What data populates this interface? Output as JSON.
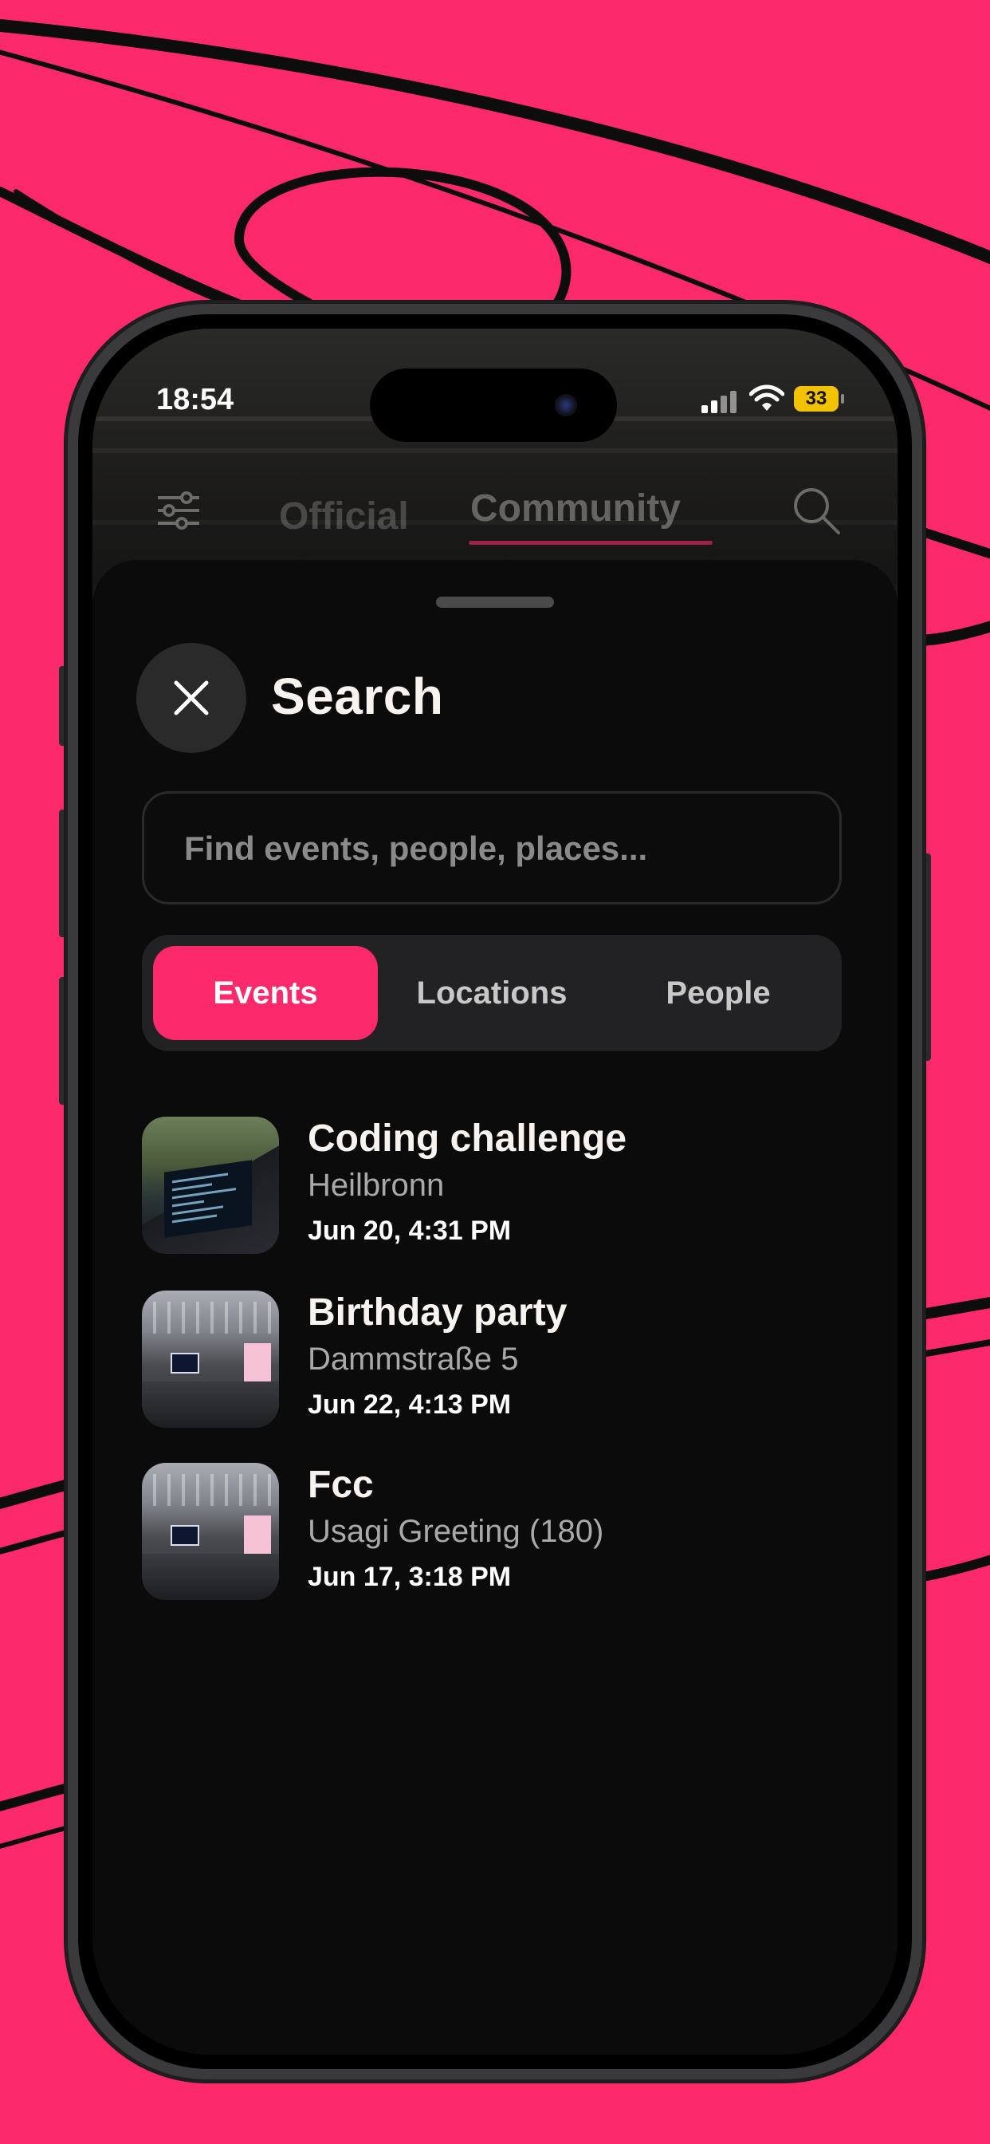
{
  "status_bar": {
    "time": "18:54",
    "battery": "33"
  },
  "top_nav": {
    "tabs": [
      {
        "label": "Official"
      },
      {
        "label": "Community"
      }
    ]
  },
  "sheet": {
    "title": "Search",
    "search_placeholder": "Find events, people, places...",
    "segments": [
      {
        "label": "Events",
        "active": true
      },
      {
        "label": "Locations",
        "active": false
      },
      {
        "label": "People",
        "active": false
      }
    ],
    "results": [
      {
        "title": "Coding challenge",
        "location": "Heilbronn",
        "date": "Jun 20, 4:31 PM"
      },
      {
        "title": "Birthday party",
        "location": "Dammstraße 5",
        "date": "Jun 22, 4:13 PM"
      },
      {
        "title": "Fcc",
        "location": "Usagi Greeting (180)",
        "date": "Jun 17, 3:18 PM"
      }
    ]
  },
  "colors": {
    "accent": "#fc2a6b",
    "sheet_bg": "#0b0b0c",
    "text": "#f8f3ee"
  }
}
